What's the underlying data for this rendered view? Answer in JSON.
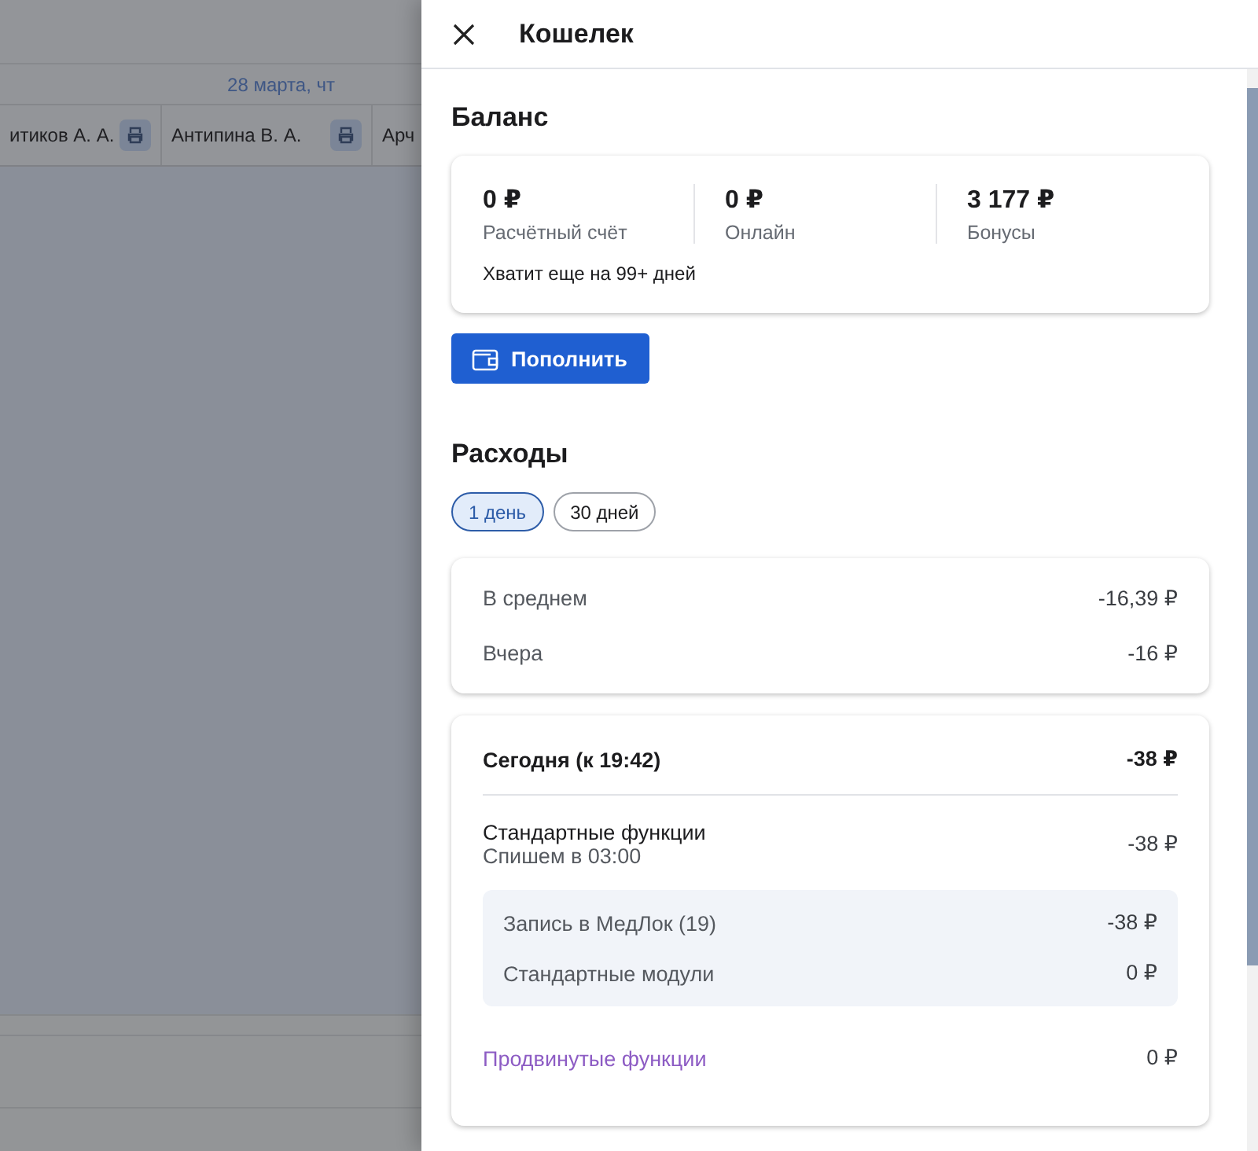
{
  "background": {
    "date_header": "28 марта, чт",
    "columns": [
      {
        "name": "итиков А. А."
      },
      {
        "name": "Антипина В. А."
      },
      {
        "name": "Арч"
      }
    ]
  },
  "drawer": {
    "title": "Кошелек",
    "balance": {
      "heading": "Баланс",
      "accounts": [
        {
          "amount": "0 ₽",
          "label": "Расчётный счёт"
        },
        {
          "amount": "0 ₽",
          "label": "Онлайн"
        },
        {
          "amount": "3 177 ₽",
          "label": "Бонусы"
        }
      ],
      "note": "Хватит еще на 99+ дней",
      "topup_button": "Пополнить"
    },
    "expenses": {
      "heading": "Расходы",
      "periods": [
        {
          "label": "1 день",
          "selected": true
        },
        {
          "label": "30 дней",
          "selected": false
        }
      ],
      "summary": [
        {
          "label": "В среднем",
          "value": "-16,39 ₽"
        },
        {
          "label": "Вчера",
          "value": "-16 ₽"
        }
      ],
      "today": {
        "title": "Сегодня (к 19:42)",
        "total": "-38 ₽",
        "groups": [
          {
            "title": "Стандартные функции",
            "subtitle": "Спишем в 03:00",
            "value": "-38 ₽",
            "items": [
              {
                "label": "Запись в МедЛок (19)",
                "value": "-38 ₽"
              },
              {
                "label": "Стандартные модули",
                "value": "0 ₽"
              }
            ]
          }
        ],
        "advanced": {
          "label": "Продвинутые функции",
          "value": "0 ₽"
        }
      }
    }
  }
}
